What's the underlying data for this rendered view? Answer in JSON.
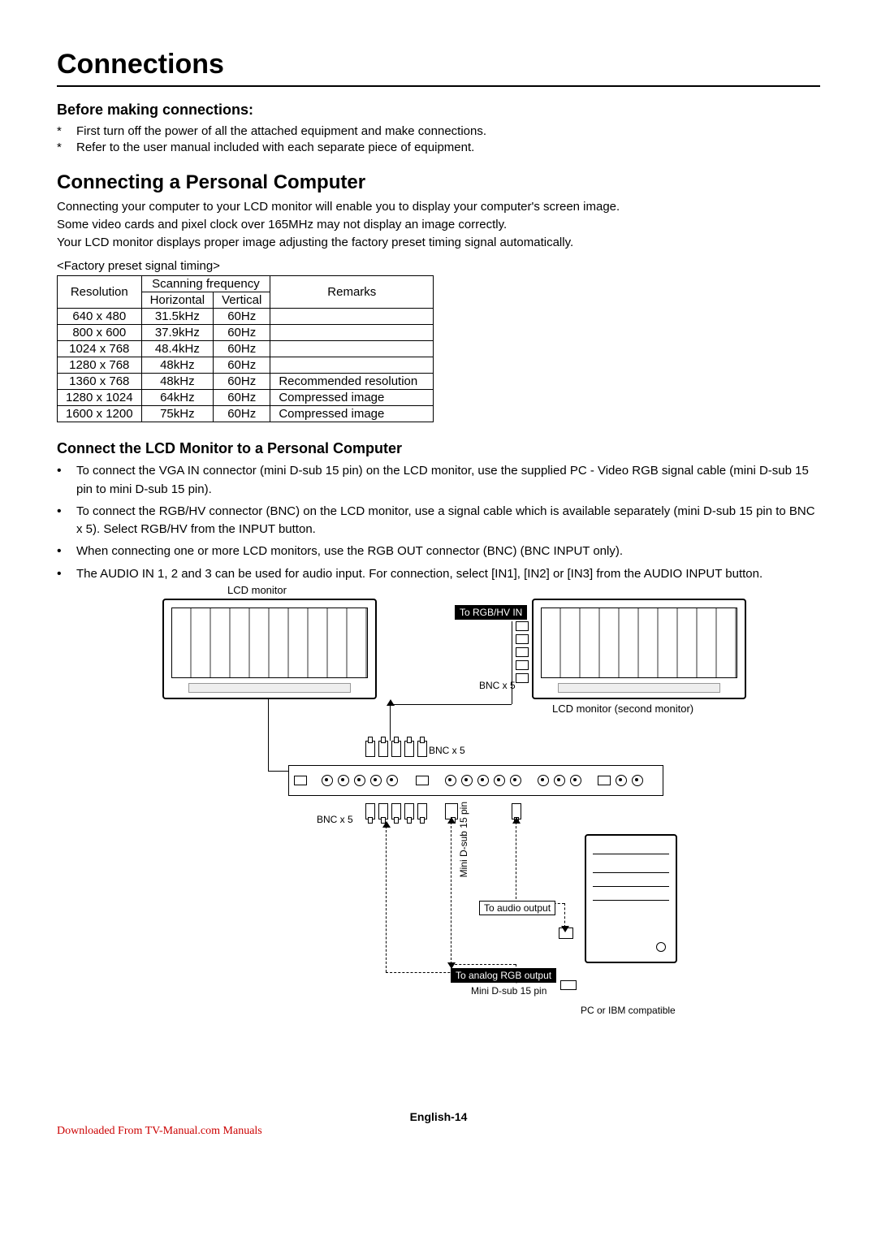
{
  "title": "Connections",
  "before": {
    "heading": "Before making connections:",
    "items": [
      "First turn off the power of all the attached equipment and make connections.",
      "Refer to the user manual included with each separate piece of equipment."
    ]
  },
  "pc": {
    "heading": "Connecting a Personal Computer",
    "para": [
      "Connecting your computer to your LCD monitor will enable you to display your computer's screen image.",
      "Some video cards and pixel clock over 165MHz may not display an image correctly.",
      "Your LCD monitor displays proper image adjusting the factory preset timing signal automatically."
    ],
    "table_caption": "<Factory preset signal timing>",
    "headers": {
      "resolution": "Resolution",
      "scanning": "Scanning frequency",
      "horizontal": "Horizontal",
      "vertical": "Vertical",
      "remarks": "Remarks"
    },
    "rows": [
      {
        "res": "640 x 480",
        "h": "31.5kHz",
        "v": "60Hz",
        "r": ""
      },
      {
        "res": "800 x 600",
        "h": "37.9kHz",
        "v": "60Hz",
        "r": ""
      },
      {
        "res": "1024 x 768",
        "h": "48.4kHz",
        "v": "60Hz",
        "r": ""
      },
      {
        "res": "1280 x 768",
        "h": "48kHz",
        "v": "60Hz",
        "r": ""
      },
      {
        "res": "1360 x 768",
        "h": "48kHz",
        "v": "60Hz",
        "r": "Recommended resolution"
      },
      {
        "res": "1280 x 1024",
        "h": "64kHz",
        "v": "60Hz",
        "r": "Compressed image"
      },
      {
        "res": "1600 x 1200",
        "h": "75kHz",
        "v": "60Hz",
        "r": "Compressed image"
      }
    ]
  },
  "connect": {
    "heading": "Connect the LCD Monitor to a Personal Computer",
    "items": [
      "To connect the VGA IN connector (mini D-sub 15 pin) on the LCD monitor, use the supplied PC - Video RGB signal cable (mini D-sub 15 pin to mini D-sub 15 pin).",
      "To connect the RGB/HV connector (BNC) on the LCD monitor, use a signal cable which is available separately (mini D-sub 15 pin to BNC x 5). Select RGB/HV from the INPUT button.",
      "When connecting one or more LCD monitors, use the RGB OUT connector (BNC) (BNC INPUT only).",
      "The AUDIO IN 1, 2 and 3 can be used for audio input. For connection, select [IN1], [IN2] or [IN3] from the AUDIO INPUT button."
    ]
  },
  "diagram": {
    "lcd_monitor": "LCD monitor",
    "lcd_monitor_second": "LCD monitor (second monitor)",
    "to_rgbhv_in": "To RGB/HV IN",
    "bnc_x5": "BNC x 5",
    "mini_dsub_15pin_v": "Mini D-sub\n15 pin",
    "to_audio_output": "To audio output",
    "to_analog_rgb_output": "To analog RGB output",
    "mini_dsub_15pin": "Mini D-sub 15 pin",
    "pc_or_ibm": "PC or IBM compatible"
  },
  "footer": "English-14",
  "download": "Downloaded From TV-Manual.com Manuals"
}
